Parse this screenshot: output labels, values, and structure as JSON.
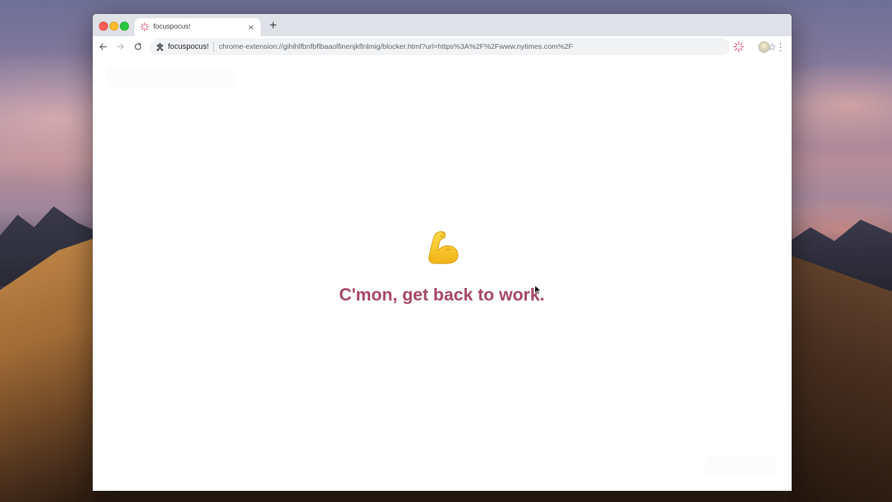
{
  "browser": {
    "tab": {
      "title": "focuspocus!",
      "favicon": "focuspocus-sparkle-icon"
    },
    "new_tab_symbol": "+",
    "close_symbol": "×",
    "omnibox": {
      "site_name": "focuspocus!",
      "url": "chrome-extension://gihihlfbnfbflbaaolfinenjkflnlmig/blocker.html?url=https%3A%2F%2Fwww.nytimes.com%2F"
    },
    "menu_symbol": "⋮"
  },
  "page": {
    "emoji": "flexed-biceps",
    "message": "C'mon, get back to work."
  },
  "colors": {
    "message": "#a6466a",
    "tab_strip": "#dee1e6",
    "omnibox_bg": "#f1f3f4"
  }
}
